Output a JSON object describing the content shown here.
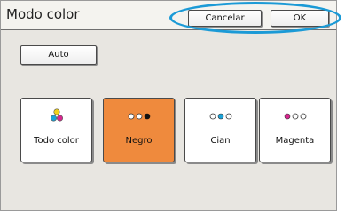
{
  "window": {
    "title": "Modo color"
  },
  "header": {
    "cancel_label": "Cancelar",
    "ok_label": "OK"
  },
  "controls": {
    "auto_label": "Auto"
  },
  "modes": [
    {
      "label": "Todo color",
      "icon": "full-color-dots-icon",
      "selected": false
    },
    {
      "label": "Negro",
      "icon": "black-dots-icon",
      "selected": true
    },
    {
      "label": "Cian",
      "icon": "cyan-dots-icon",
      "selected": false
    },
    {
      "label": "Magenta",
      "icon": "magenta-dots-icon",
      "selected": false
    }
  ],
  "colors": {
    "accent_selected": "#ef8a3d",
    "highlight": "#1b9ad6",
    "cyan": "#1aa3d9",
    "magenta": "#d8268f",
    "yellow": "#f2d21a",
    "black": "#111111"
  }
}
